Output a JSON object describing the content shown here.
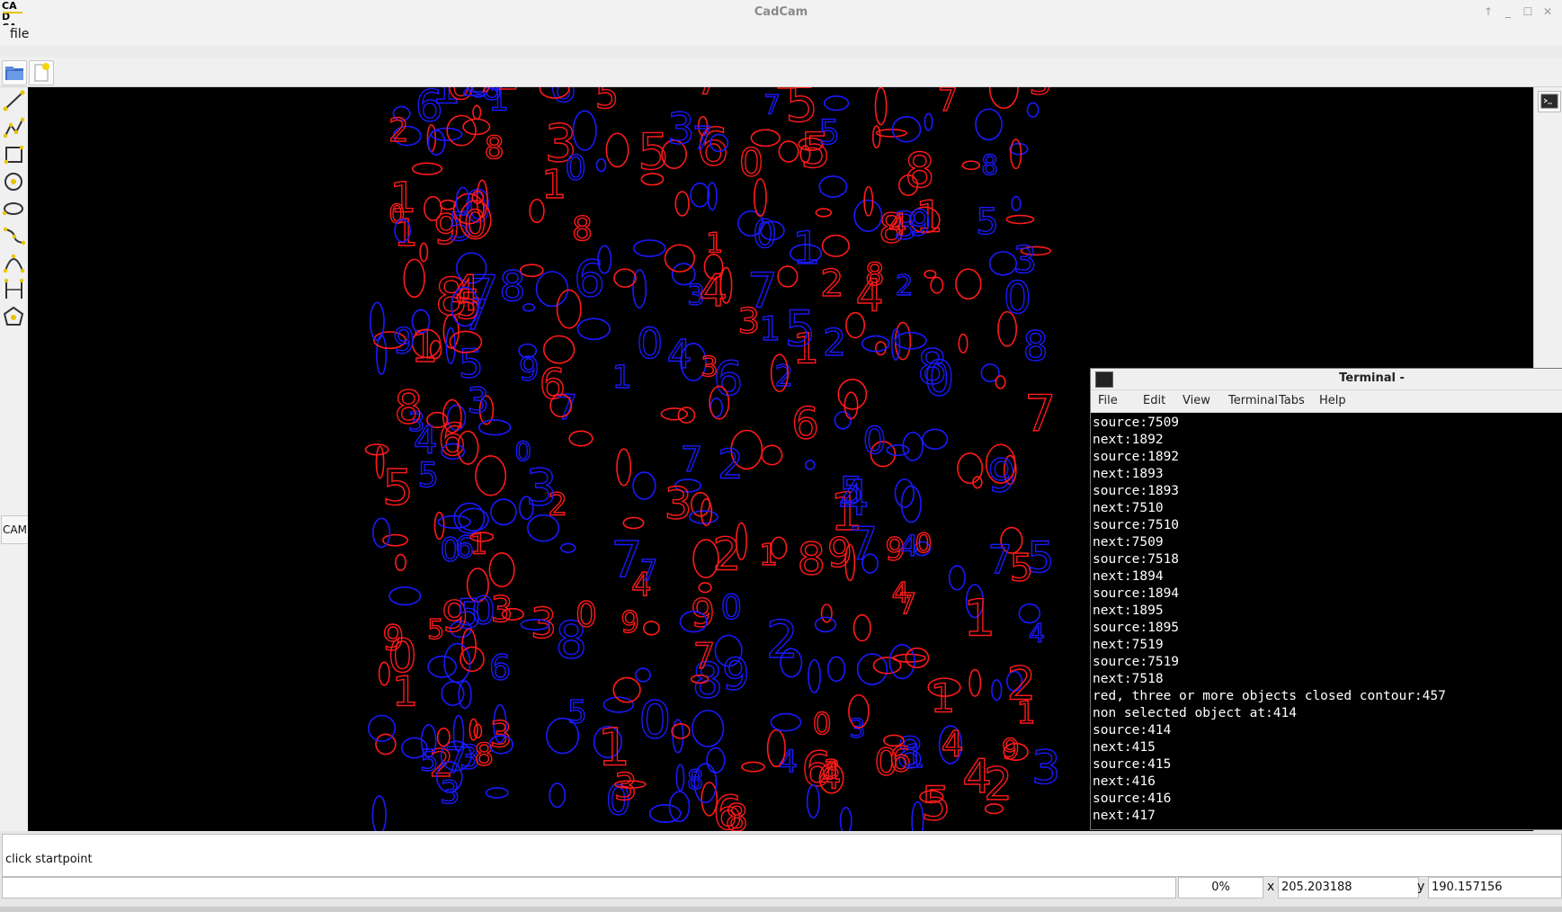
{
  "window": {
    "title": "CadCam",
    "logo": "CAD CAM"
  },
  "menu": {
    "file_label": "file"
  },
  "toolbar": {
    "icons": [
      "open-folder-icon",
      "new-document-icon"
    ]
  },
  "tools": {
    "icons": [
      "line-tool-icon",
      "polyline-tool-icon",
      "rectangle-tool-icon",
      "circle-tool-icon",
      "ellipse-tool-icon",
      "spline-tool-icon",
      "arc-tool-icon",
      "dimension-tool-icon",
      "polygon-tool-icon"
    ],
    "cam_label": "CAM"
  },
  "terminal": {
    "title": "Terminal -",
    "menu": [
      "File",
      "Edit",
      "View",
      "Terminal",
      "Tabs",
      "Help"
    ],
    "lines": [
      "source:7509",
      "next:1892",
      "source:1892",
      "next:1893",
      "source:1893",
      "next:7510",
      "source:7510",
      "next:7509",
      "source:7518",
      "next:1894",
      "source:1894",
      "next:1895",
      "source:1895",
      "next:7519",
      "source:7519",
      "next:7518",
      "red, three or more objects closed contour:457",
      "non selected object at:414",
      "source:414",
      "next:415",
      "source:415",
      "next:416",
      "source:416",
      "next:417"
    ]
  },
  "status": {
    "message": "click startpoint",
    "progress": "0%",
    "x_label": "x",
    "x_value": "205.203188",
    "y_label": "y",
    "y_value": "190.157156"
  },
  "colors": {
    "contour_red": "#ff1a1a",
    "contour_blue": "#1a1aff",
    "canvas_bg": "#000000"
  }
}
